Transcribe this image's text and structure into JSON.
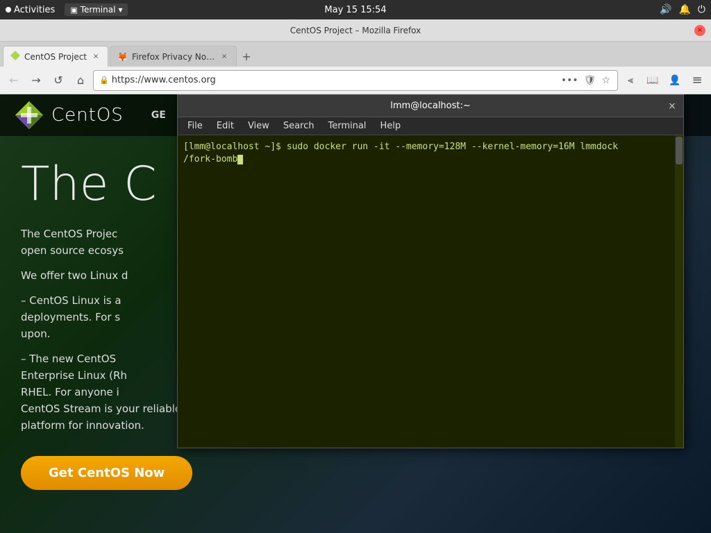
{
  "gnome": {
    "activities_label": "Activities",
    "terminal_label": "Terminal",
    "terminal_arrow": "▾",
    "datetime": "May 15  15:54"
  },
  "firefox": {
    "window_title": "CentOS Project – Mozilla Firefox",
    "close_label": "×",
    "tabs": [
      {
        "id": "tab-centos",
        "favicon": "🌐",
        "label": "CentOS Project",
        "active": true
      },
      {
        "id": "tab-privacy",
        "favicon": "🦊",
        "label": "Firefox Privacy Notice — …",
        "active": false
      }
    ],
    "new_tab_label": "+",
    "nav": {
      "back_label": "←",
      "forward_label": "→",
      "reload_label": "↺",
      "home_label": "⌂"
    },
    "urlbar": {
      "lock_label": "🔒",
      "url": "https://www.centos.org",
      "more_label": "•••",
      "shield_label": "🛡",
      "star_label": "☆"
    },
    "toolbar_right": {
      "library_label": "⫷",
      "pocket_label": "📖",
      "profile_label": "👤",
      "menu_label": "≡"
    }
  },
  "centos": {
    "logo_text": "CentOS",
    "nav_partial": "GE",
    "main_title": "The C",
    "description_lines": [
      "The CentOS Projec",
      "open source ecosys",
      "",
      "We offer two Linux",
      "",
      "– CentOS Linux is a",
      "deployments. For s",
      "upon.",
      "",
      "– The new CentOS",
      "Enterprise Linux (Rh",
      "RHEL. For anyone i",
      "CentOS Stream is your reliable platform for innovation."
    ],
    "cta_label": "Get CentOS Now"
  },
  "terminal": {
    "title": "lmm@localhost:~",
    "close_label": "×",
    "menu_items": [
      "File",
      "Edit",
      "View",
      "Search",
      "Terminal",
      "Help"
    ],
    "command_line": "[lmm@localhost ~]$ sudo docker run -it --memory=128M --kernel-memory=16M lmmdock\n/fork-bomb",
    "prompt_text": "[lmm@localhost ~]$ sudo docker run -it --memory=128M --kernel-memory=16M lmmdock",
    "prompt_second": "/fork-bomb"
  }
}
